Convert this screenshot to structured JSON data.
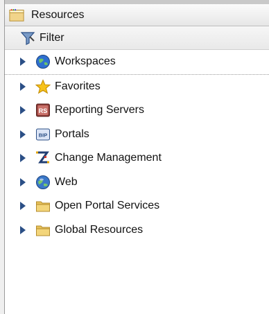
{
  "panel": {
    "title": "Resources",
    "title_icon": "folder-open-icon"
  },
  "filter": {
    "label": "Filter",
    "icon": "filter-funnel-icon"
  },
  "tree": {
    "items": [
      {
        "label": "Workspaces",
        "icon": "globe-blue-icon"
      },
      {
        "label": "Favorites",
        "icon": "star-icon"
      },
      {
        "label": "Reporting Servers",
        "icon": "rs-badge-icon"
      },
      {
        "label": "Portals",
        "icon": "bip-badge-icon"
      },
      {
        "label": "Change Management",
        "icon": "change-management-icon"
      },
      {
        "label": "Web",
        "icon": "globe-web-icon"
      },
      {
        "label": "Open Portal Services",
        "icon": "folder-icon"
      },
      {
        "label": "Global Resources",
        "icon": "folder-icon"
      }
    ]
  },
  "colors": {
    "expander": "#2b4f86",
    "folder": "#e7c25a",
    "header_bg": "#eeeeee"
  }
}
